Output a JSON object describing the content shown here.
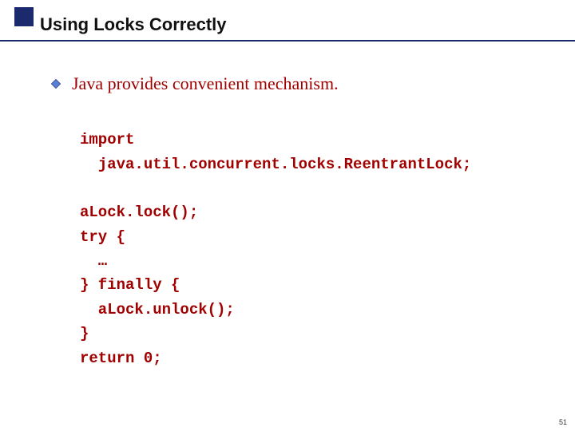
{
  "title": "Using Locks Correctly",
  "bullet": "Java provides convenient mechanism.",
  "code": {
    "l1": "import",
    "l2": "  java.util.concurrent.locks.ReentrantLock;",
    "l3": "aLock.lock();",
    "l4": "try {",
    "l5": "  …",
    "l6": "} finally {",
    "l7": "  aLock.unlock();",
    "l8": "}",
    "l9": "return 0;"
  },
  "page_number": "51",
  "colors": {
    "accent": "#1a2a6c",
    "text_red": "#a00000"
  }
}
